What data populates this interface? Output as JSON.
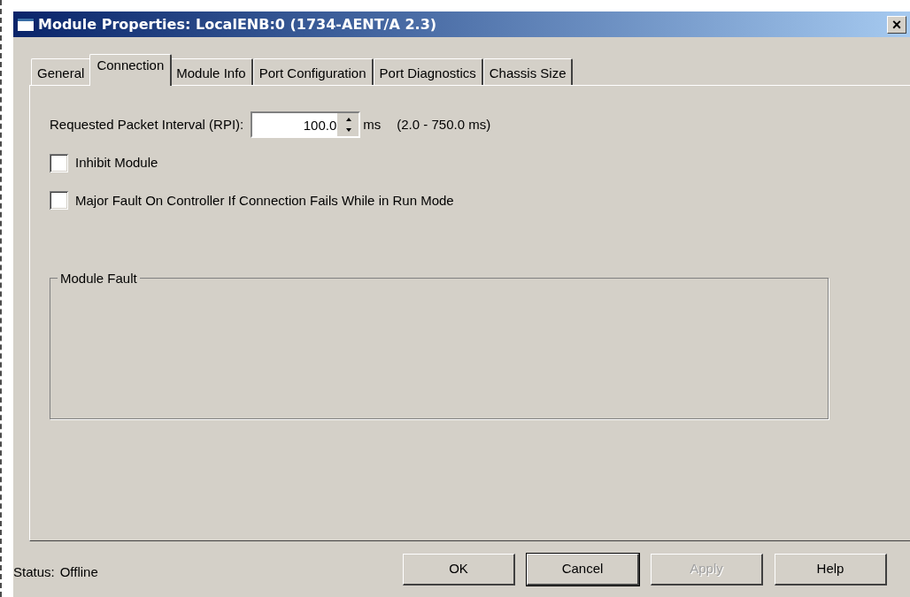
{
  "window": {
    "title": "Module Properties: LocalENB:0 (1734-AENT/A 2.3)",
    "close": "×"
  },
  "tabs": [
    {
      "label": "General",
      "selected": false
    },
    {
      "label": "Connection",
      "selected": true
    },
    {
      "label": "Module Info",
      "selected": false
    },
    {
      "label": "Port Configuration",
      "selected": false
    },
    {
      "label": "Port Diagnostics",
      "selected": false
    },
    {
      "label": "Chassis Size",
      "selected": false
    }
  ],
  "rpi": {
    "label": "Requested Packet Interval (RPI):",
    "value": "100.0",
    "unit": "ms",
    "range": "(2.0 - 750.0 ms)"
  },
  "checkboxes": [
    {
      "label": "Inhibit Module",
      "checked": false
    },
    {
      "label": "Major Fault On Controller If Connection Fails While in Run Mode",
      "checked": false
    }
  ],
  "module_fault": {
    "title": "Module Fault"
  },
  "status_bar": {
    "label": "Status:",
    "value": "Offline"
  },
  "buttons": [
    {
      "label": "OK",
      "disabled": false,
      "default": false
    },
    {
      "label": "Cancel",
      "disabled": false,
      "default": true
    },
    {
      "label": "Apply",
      "disabled": true,
      "default": false
    },
    {
      "label": "Help",
      "disabled": false,
      "default": false
    }
  ]
}
